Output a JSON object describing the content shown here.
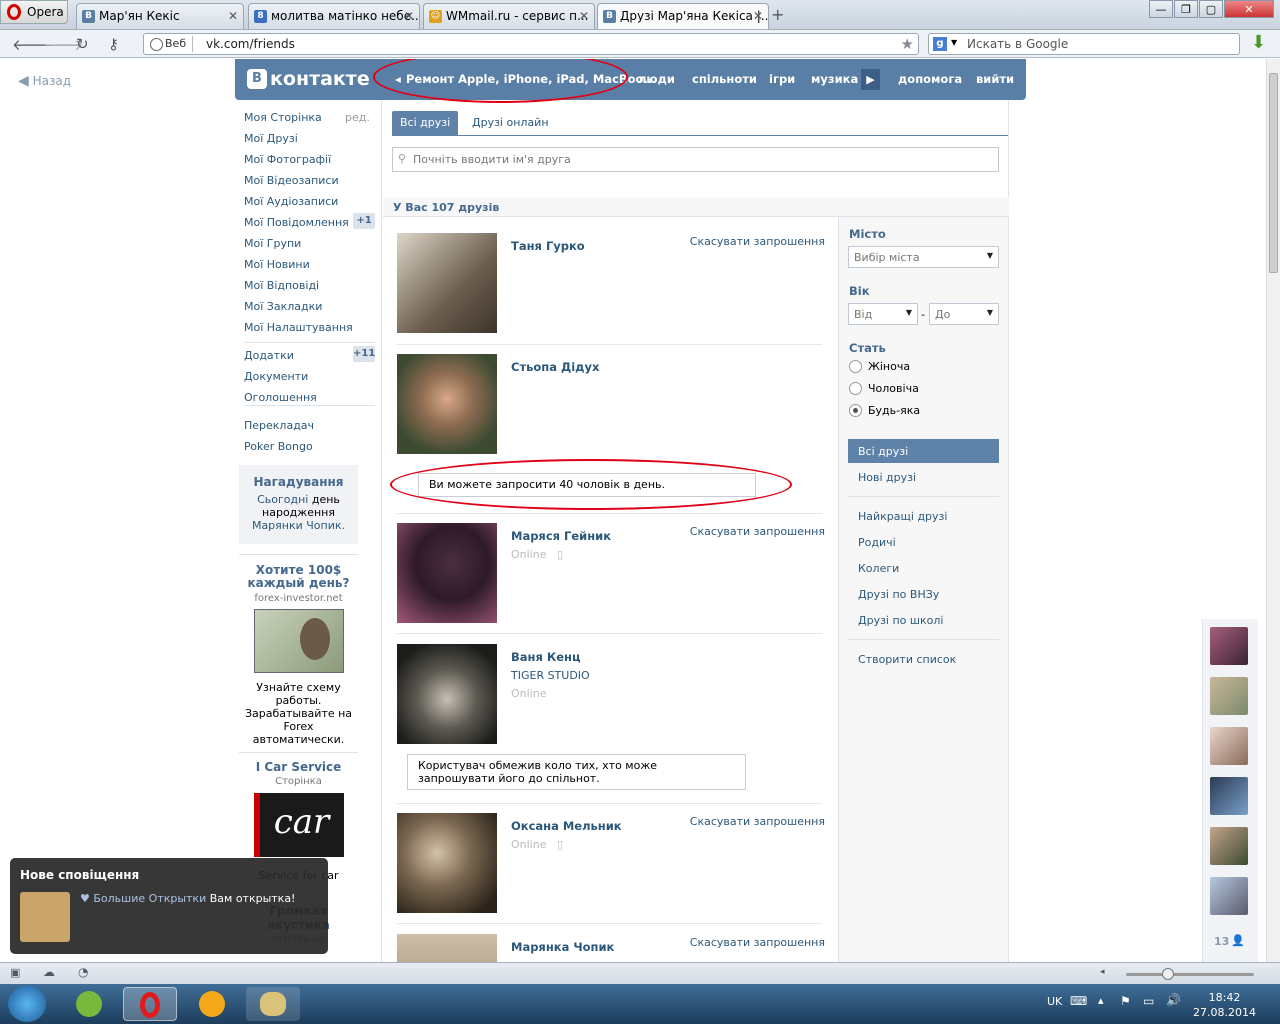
{
  "browser": {
    "menu_label": "Opera",
    "tabs": [
      {
        "label": "Мар'ян Кекіс",
        "favicon": "В",
        "color": "#5a7fa6"
      },
      {
        "label": "молитва матінко небе...",
        "favicon": "8",
        "color": "#3b6fc4"
      },
      {
        "label": "WMmail.ru - сервис п...",
        "favicon": "☺",
        "color": "#e0a020"
      },
      {
        "label": "Друзі Мар'яна Кекіса |...",
        "favicon": "В",
        "color": "#5a7fa6"
      }
    ],
    "chip": "Веб",
    "url": "vk.com/friends",
    "search_placeholder": "Искать в Google"
  },
  "page": {
    "back": "Назад",
    "logo": "контакте",
    "logo_mark": "В",
    "nav": {
      "promo": "Ремонт Apple, iPhone, iPad, MacBoo...",
      "items": [
        "люди",
        "спільноти",
        "ігри",
        "музика"
      ],
      "help": "допомога",
      "logout": "вийти"
    },
    "left_menu": [
      {
        "label": "Моя Сторінка",
        "extra": "ред."
      },
      {
        "label": "Мої Друзі"
      },
      {
        "label": "Мої Фотографії"
      },
      {
        "label": "Мої Відеозаписи"
      },
      {
        "label": "Мої Аудіозаписи"
      },
      {
        "label": "Мої Повідомлення",
        "badge": "+1"
      },
      {
        "label": "Мої Групи"
      },
      {
        "label": "Мої Новини"
      },
      {
        "label": "Мої Відповіді"
      },
      {
        "label": "Мої Закладки"
      },
      {
        "label": "Мої Налаштування"
      },
      {
        "label": "Додатки",
        "badge": "+11"
      },
      {
        "label": "Документи"
      },
      {
        "label": "Оголошення"
      },
      {
        "label": "Перекладач"
      },
      {
        "label": "Poker Bongo"
      }
    ],
    "reminder": {
      "title": "Нагадування",
      "text1": "Сьогодні",
      "text2": "день народження",
      "text3": "Марянки Чопик."
    },
    "ad1": {
      "title": "Хотите 100$ каждый день?",
      "domain": "forex-investor.net",
      "text": "Узнайте схему работы. Зарабатывайте на Forex автоматически."
    },
    "ad2": {
      "title": "I Car Service",
      "sub": "Сторінка",
      "img_text": "car",
      "caption": "Service for car"
    },
    "ad3": {
      "title": "Громкая акустика",
      "domain": "rozetka.ua"
    },
    "tabs": [
      "Всі друзі",
      "Друзі онлайн"
    ],
    "search_placeholder": "Почніть вводити ім'я друга",
    "count_label": "У Вас 107 друзів",
    "friends": [
      {
        "name": "Таня Гурко",
        "action": "Скасувати запрошення"
      },
      {
        "name": "Стьопа Дідух"
      },
      {
        "name": "Маряся Гейник",
        "status": "Online",
        "action": "Скасувати запрошення"
      },
      {
        "name": "Ваня Кенц",
        "sub": "TIGER STUDIO",
        "status": "Online"
      },
      {
        "name": "Оксана Мельник",
        "status": "Online",
        "action": "Скасувати запрошення"
      },
      {
        "name": "Марянка Чопик",
        "action": "Скасувати запрошення"
      }
    ],
    "notice1": "Ви можете запросити 40 чоловік в день.",
    "notice2": "Користувач обмежив коло тих, хто може запрошувати його до спільнот.",
    "filter": {
      "city_label": "Місто",
      "city_value": "Вибір міста",
      "age_label": "Вік",
      "age_from": "Від",
      "age_to": "До",
      "age_dash": "-",
      "gender_label": "Стать",
      "genders": [
        "Жіноча",
        "Чоловіча",
        "Будь-яка"
      ],
      "selected_gender": 2
    },
    "sections": [
      "Всі друзі",
      "Нові друзі",
      "Найкращі друзі",
      "Родичі",
      "Колеги",
      "Друзі по ВНЗу",
      "Друзі по школі",
      "Створити список"
    ],
    "online_count": "13"
  },
  "notification": {
    "title": "Нове сповіщення",
    "from": "Большие Открытки",
    "text": "Вам открытка!"
  },
  "taskbar": {
    "lang": "UK",
    "time": "18:42",
    "date": "27.08.2014"
  }
}
